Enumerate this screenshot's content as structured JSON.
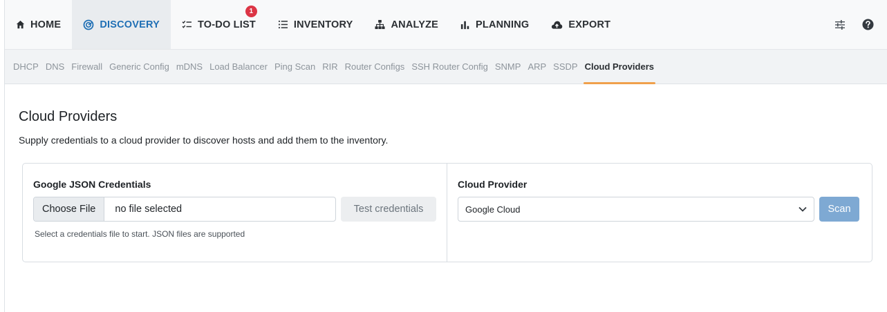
{
  "topnav": {
    "items": [
      {
        "label": "HOME",
        "icon": "home-icon"
      },
      {
        "label": "DISCOVERY",
        "icon": "radar-icon"
      },
      {
        "label": "TO-DO LIST",
        "icon": "checklist-icon",
        "badge": "1"
      },
      {
        "label": "INVENTORY",
        "icon": "list-icon"
      },
      {
        "label": "ANALYZE",
        "icon": "network-icon"
      },
      {
        "label": "PLANNING",
        "icon": "bar-chart-icon"
      },
      {
        "label": "EXPORT",
        "icon": "cloud-upload-icon"
      }
    ],
    "active": "DISCOVERY",
    "right_icons": [
      "sliders-icon",
      "help-icon"
    ]
  },
  "subnav": {
    "items": [
      "DHCP",
      "DNS",
      "Firewall",
      "Generic Config",
      "mDNS",
      "Load Balancer",
      "Ping Scan",
      "RIR",
      "Router Configs",
      "SSH Router Config",
      "SNMP",
      "ARP",
      "SSDP",
      "Cloud Providers"
    ],
    "active": "Cloud Providers"
  },
  "page": {
    "title": "Cloud Providers",
    "description": "Supply credentials to a cloud provider to discover hosts and add them to the inventory."
  },
  "credentials": {
    "label": "Google JSON Credentials",
    "choose_file": "Choose File",
    "file_name": "no file selected",
    "test_button": "Test credentials",
    "help": "Select a credentials file to start. JSON files are supported"
  },
  "provider": {
    "label": "Cloud Provider",
    "selected": "Google Cloud",
    "scan_button": "Scan"
  },
  "colors": {
    "accent": "#1f6fb5",
    "tab_underline": "#f0a04b",
    "badge": "#dc3545",
    "scan_button": "#7ea9d3"
  }
}
